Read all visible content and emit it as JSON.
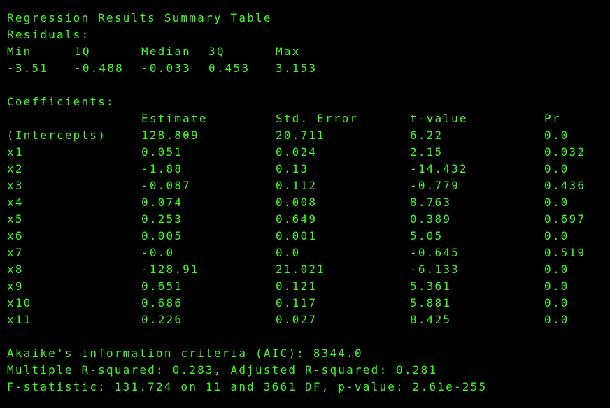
{
  "title": "Regression Results Summary Table",
  "residuals": {
    "label": "Residuals:",
    "headers": [
      "Min",
      "1Q",
      "Median",
      "3Q",
      "Max"
    ],
    "values": [
      "-3.51",
      "-0.488",
      "-0.033",
      "0.453",
      "3.153"
    ]
  },
  "coefficients": {
    "label": "Coefficients:",
    "headers": [
      "",
      "Estimate",
      "Std. Error",
      "t-value",
      "Pr"
    ],
    "rows": [
      [
        "(Intercepts)",
        "128.809",
        "20.711",
        "6.22",
        "0.0"
      ],
      [
        "x1",
        "0.051",
        "0.024",
        "2.15",
        "0.032"
      ],
      [
        "x2",
        "-1.88",
        "0.13",
        "-14.432",
        "0.0"
      ],
      [
        "x3",
        "-0.087",
        "0.112",
        "-0.779",
        "0.436"
      ],
      [
        "x4",
        "0.074",
        "0.008",
        "8.763",
        "0.0"
      ],
      [
        "x5",
        "0.253",
        "0.649",
        "0.389",
        "0.697"
      ],
      [
        "x6",
        "0.005",
        "0.001",
        "5.05",
        "0.0"
      ],
      [
        "x7",
        "-0.0",
        "0.0",
        "-0.645",
        "0.519"
      ],
      [
        "x8",
        "-128.91",
        "21.021",
        "-6.133",
        "0.0"
      ],
      [
        "x9",
        "0.651",
        "0.121",
        "5.361",
        "0.0"
      ],
      [
        "x10",
        "0.686",
        "0.117",
        "5.881",
        "0.0"
      ],
      [
        "x11",
        "0.226",
        "0.027",
        "8.425",
        "0.0"
      ]
    ]
  },
  "summary": {
    "aic": "Akaike's information criteria (AIC): 8344.0",
    "r_squared": "Multiple R-squared: 0.283, Adjusted R-squared: 0.281",
    "f_statistic": "F-statistic: 131.724 on 11 and 3661 DF, p-value: 2.61e-255"
  },
  "colors": {
    "background": "#000000",
    "text": "#39ff14"
  }
}
